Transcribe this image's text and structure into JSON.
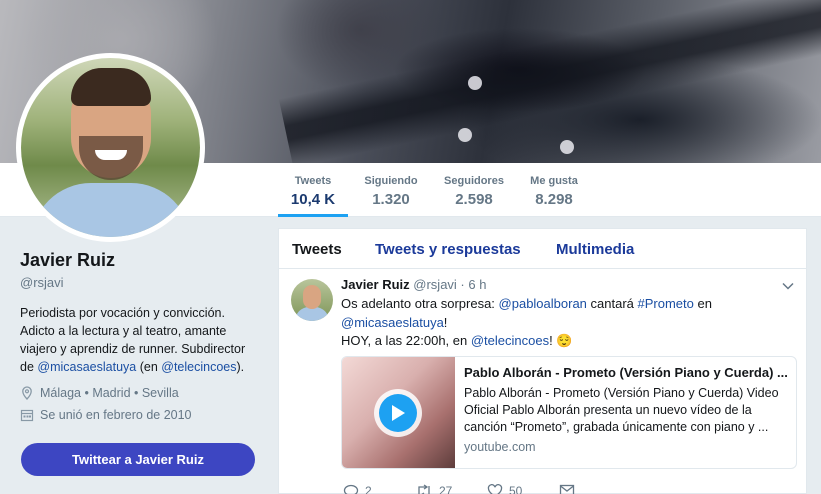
{
  "profile": {
    "name": "Javier Ruiz",
    "handle": "@rsjavi",
    "bio_part1": "Periodista por vocación y convicción. Adicto a la lectura y al teatro, amante viajero y aprendiz de runner. Subdirector de ",
    "bio_link1": "@micasaeslatuya",
    "bio_part2": " (en ",
    "bio_link2": "@telecincoes",
    "bio_part3": ").",
    "location": "Málaga • Madrid • Sevilla",
    "joined": "Se unió en febrero de 2010",
    "tweet_button": "Twittear a Javier Ruiz"
  },
  "stats": [
    {
      "label": "Tweets",
      "value": "10,4 K"
    },
    {
      "label": "Siguiendo",
      "value": "1.320"
    },
    {
      "label": "Seguidores",
      "value": "2.598"
    },
    {
      "label": "Me gusta",
      "value": "8.298"
    }
  ],
  "tabs": [
    "Tweets",
    "Tweets y respuestas",
    "Multimedia"
  ],
  "tweet": {
    "name": "Javier Ruiz",
    "handle_time": "@rsjavi · 6 h",
    "line1_a": "Os adelanto otra sorpresa: ",
    "line1_link": "@pabloalboran",
    "line1_b": " cantará ",
    "line1_tag": "#Prometo",
    "line1_c": " en",
    "line2_link": "@micasaeslatuya",
    "line2_b": "!",
    "line3_a": "HOY, a las 22:00h, en ",
    "line3_link": "@telecincoes",
    "line3_b": "! ",
    "emoji": "😌",
    "card_title": "Pablo Alborán - Prometo (Versión Piano y Cuerda) ...",
    "card_desc": "Pablo Alborán - Prometo (Versión Piano y Cuerda) Video Oficial Pablo Alborán presenta un nuevo vídeo de la canción “Prometo”, grabada únicamente con piano y ...",
    "card_domain": "youtube.com",
    "reply_count": "2",
    "retweet_count": "27",
    "like_count": "50"
  },
  "colors": {
    "accent": "#1da1f2",
    "button": "#3d46c2",
    "link": "#1b4fa3"
  }
}
